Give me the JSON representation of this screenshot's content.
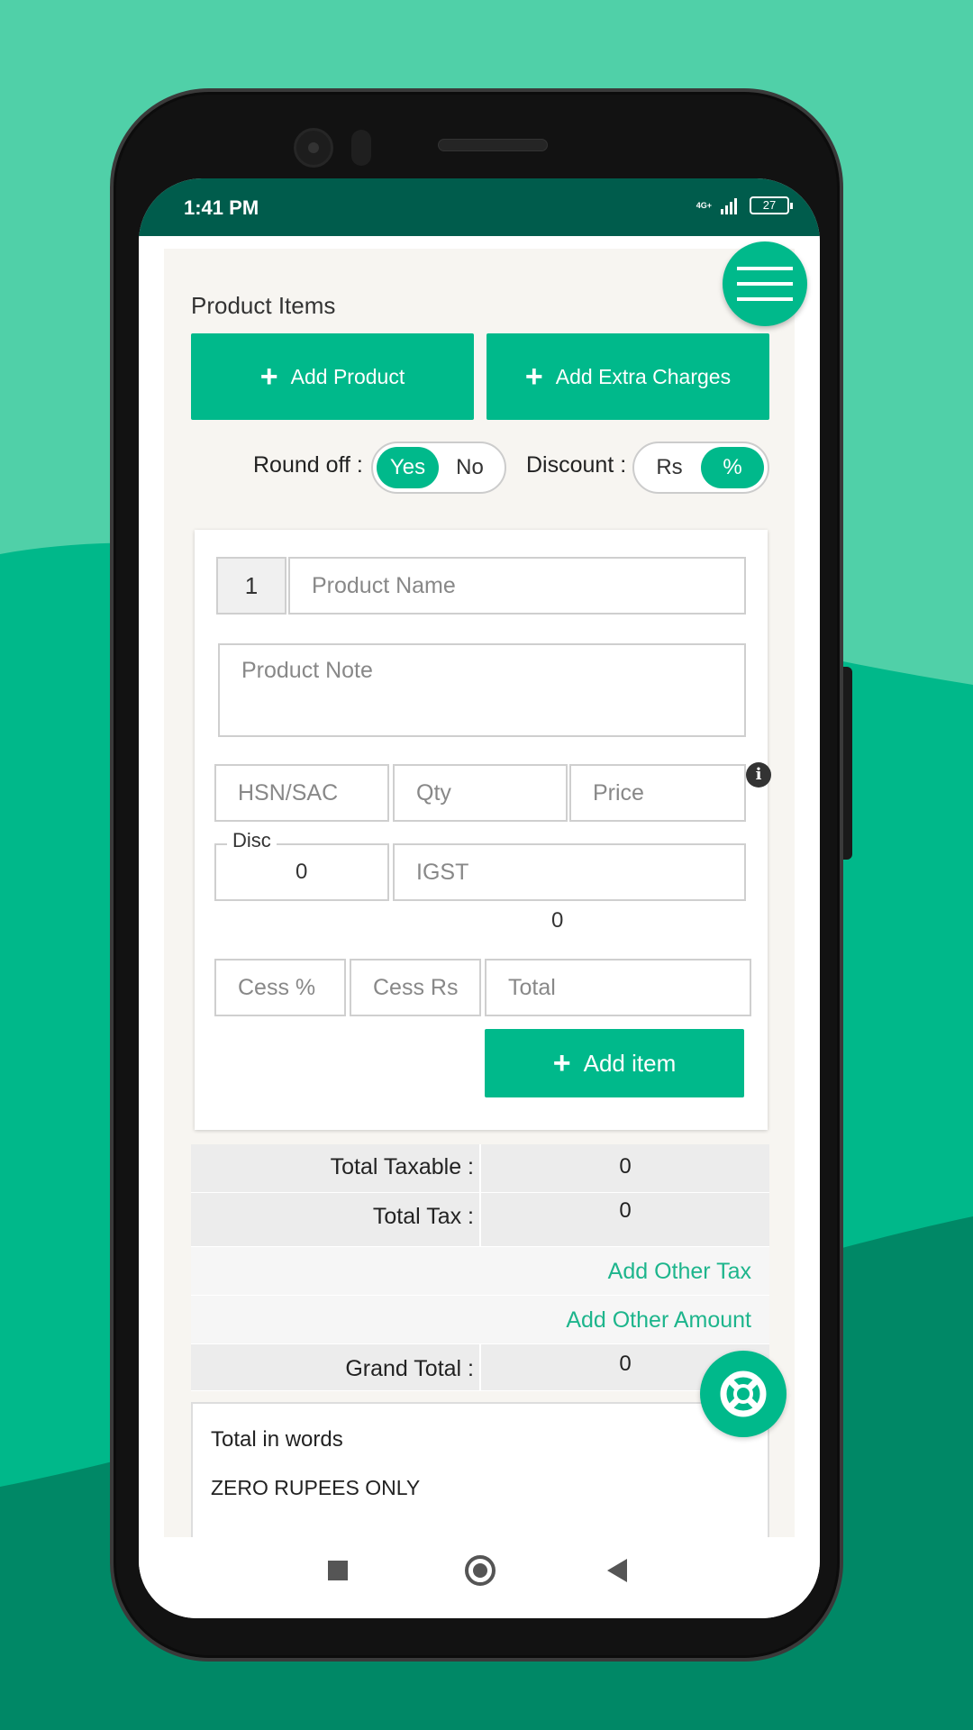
{
  "colors": {
    "accent": "#00b98b",
    "status_bar": "#005c4c",
    "link": "#1db58c",
    "bg_light": "#50d0a8",
    "bg_mid": "#00b88a",
    "bg_dark": "#008866"
  },
  "status_bar": {
    "time": "1:41 PM",
    "network": "4G+",
    "battery": "27"
  },
  "menu": {
    "icon": "hamburger-menu-icon"
  },
  "product_items": {
    "title": "Product Items",
    "add_product_label": "Add Product",
    "add_extra_charges_label": "Add Extra Charges",
    "round_off": {
      "label": "Round off :",
      "options": [
        "Yes",
        "No"
      ],
      "selected": "Yes"
    },
    "discount": {
      "label": "Discount :",
      "options": [
        "Rs",
        "%"
      ],
      "selected": "%"
    }
  },
  "item_form": {
    "index": "1",
    "product_name_placeholder": "Product Name",
    "product_note_placeholder": "Product Note",
    "hsn_placeholder": "HSN/SAC",
    "qty_placeholder": "Qty",
    "price_placeholder": "Price",
    "disc_label": "Disc",
    "disc_value": "0",
    "igst_placeholder": "IGST",
    "igst_value": "0",
    "cess_percent_placeholder": "Cess %",
    "cess_rs_placeholder": "Cess Rs",
    "total_placeholder": "Total",
    "add_item_label": "Add item"
  },
  "totals": {
    "total_taxable_label": "Total Taxable :",
    "total_taxable_value": "0",
    "total_tax_label": "Total Tax :",
    "total_tax_value": "0",
    "add_other_tax_label": "Add Other Tax",
    "add_other_amount_label": "Add Other Amount",
    "grand_total_label": "Grand Total :",
    "grand_total_value": "0"
  },
  "words": {
    "title": "Total in words",
    "text": "ZERO RUPEES ONLY"
  },
  "help": {
    "icon": "lifebuoy-icon"
  },
  "nav": {
    "recents_icon": "square-icon",
    "home_icon": "circle-home-icon",
    "back_icon": "back-triangle-icon"
  }
}
